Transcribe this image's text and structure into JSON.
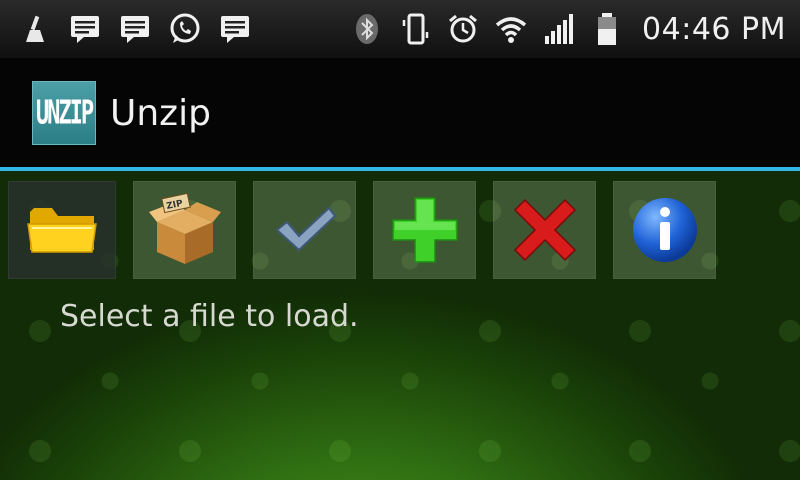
{
  "status_bar": {
    "time": "04:46 PM",
    "left_icons": [
      "broom-icon",
      "message-icon",
      "message-icon",
      "whatsapp-icon",
      "message-icon"
    ],
    "right_icons": [
      "bluetooth-icon",
      "vibrate-icon",
      "alarm-icon",
      "wifi-icon",
      "signal-icon",
      "battery-icon"
    ]
  },
  "action_bar": {
    "logo_text": "UNZIP",
    "title": "Unzip",
    "accent_color": "#33b5e5"
  },
  "toolbar": {
    "buttons": [
      {
        "icon": "folder-icon",
        "selected": true
      },
      {
        "icon": "zip-box-icon",
        "selected": false
      },
      {
        "icon": "checkmark-icon",
        "selected": false
      },
      {
        "icon": "plus-icon",
        "selected": false
      },
      {
        "icon": "x-icon",
        "selected": false
      },
      {
        "icon": "info-icon",
        "selected": false
      }
    ]
  },
  "main": {
    "message": "Select a file to load."
  }
}
